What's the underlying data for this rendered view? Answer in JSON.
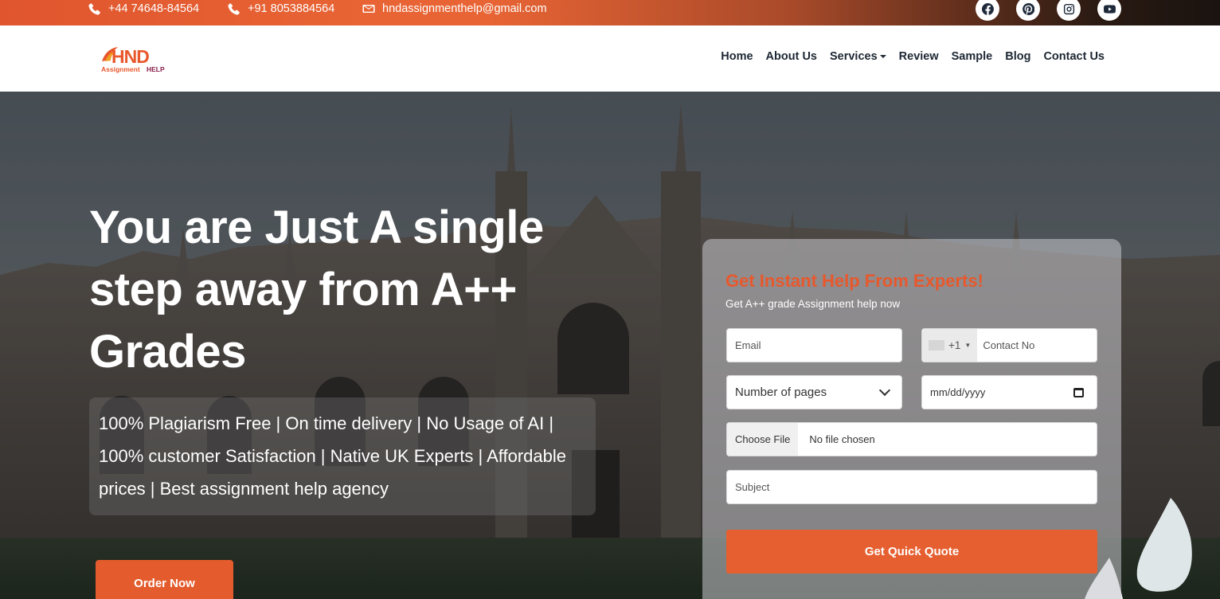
{
  "topbar": {
    "phone_uk": "+44 74648-84564",
    "phone_in": "+91 8053884564",
    "email": "hndassignmenthelp@gmail.com",
    "socials": [
      "facebook-icon",
      "pinterest-icon",
      "instagram-icon",
      "youtube-icon"
    ]
  },
  "logo": {
    "text_main": "HND",
    "text_sub_1": "Assignment",
    "text_sub_2": "HELP"
  },
  "nav": {
    "home": "Home",
    "about": "About Us",
    "services": "Services",
    "review": "Review",
    "sample": "Sample",
    "blog": "Blog",
    "contact": "Contact Us"
  },
  "hero": {
    "headline_1": "You are Just A single",
    "headline_2": "step away from A++",
    "headline_3": "Grades",
    "features_1": "100% Plagiarism Free | On time delivery | No Usage of AI |",
    "features_2": "100% customer Satisfaction | Native UK Experts | Affordable",
    "features_3": "prices | Best assignment help agency",
    "order_button": "Order Now"
  },
  "form": {
    "title": "Get Instant Help From Experts!",
    "subtitle": "Get A++ grade Assignment help now",
    "email_placeholder": "Email",
    "phone_code": "+1",
    "contact_placeholder": "Contact No",
    "pages_select": "Number of pages",
    "date_placeholder": "mm/dd/yyyy",
    "file_button": "Choose File",
    "file_status": "No file chosen",
    "subject_placeholder": "Subject",
    "submit": "Get Quick Quote"
  },
  "colors": {
    "accent": "#e65f30",
    "nav_text": "#1d2733"
  }
}
